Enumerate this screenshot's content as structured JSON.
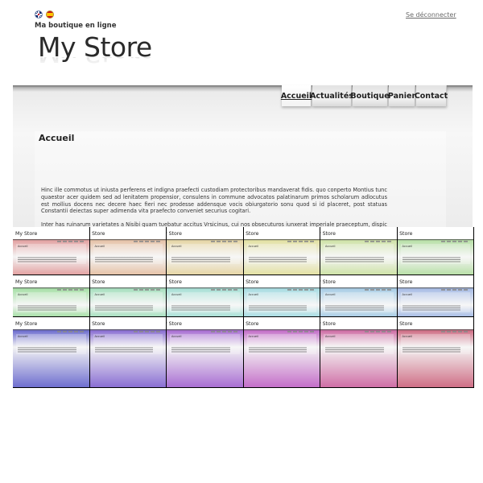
{
  "header": {
    "flags": [
      {
        "icon": "uk-flag-icon",
        "color": "#012169"
      },
      {
        "icon": "spain-flag-icon",
        "color": "#c60b1e"
      }
    ],
    "logout_label": "Se déconnecter",
    "tagline": "Ma boutique en ligne",
    "store_title": "My Store"
  },
  "nav": {
    "items": [
      {
        "label": "Accueil",
        "active": true
      },
      {
        "label": "Actualités",
        "active": false
      },
      {
        "label": "Boutique",
        "active": false
      },
      {
        "label": "Panier",
        "active": false
      },
      {
        "label": "Contact",
        "active": false
      }
    ]
  },
  "main": {
    "heading": "Accueil",
    "paragraph1": "Hinc ille commotus ut iniusta perferens et indigna praefecti custodiam protectoribus mandaverat fidis. quo conperto Montius tunc quaestor acer quidem sed ad lenitatem propensior, consulens in commune advocatos palatinarum primos scholarum adlocutus est mollius docens nec decere haec fieri nec prodesse addensque vocis obiurgatorio sonu quod si id placeret, post statuas Constantii deiectas super adimenda vita praefecto conveniet securius cogitari.",
    "paragraph2": "Inter has ruinarum varietates a Nisibi quam tuebatur accitus Vrsicinus, cui nos obsecuturos iunxerat imperiale praeceptum, dispicere litis"
  },
  "thumbnails": {
    "logo_text": "My Store",
    "logo_text_cropped": "y Store",
    "heading": "Accueil",
    "rows": [
      [
        {
          "color": "#e3a3a3",
          "logo": "full"
        },
        {
          "color": "#e6c3a8",
          "logo": "cropped"
        },
        {
          "color": "#e6d6a6",
          "logo": "cropped"
        },
        {
          "color": "#e3e1a3",
          "logo": "cropped"
        },
        {
          "color": "#cfe3a8",
          "logo": "cropped"
        },
        {
          "color": "#b9e0a8",
          "logo": "cropped"
        }
      ],
      [
        {
          "color": "#a8e0a8",
          "logo": "full"
        },
        {
          "color": "#a8e0c0",
          "logo": "cropped"
        },
        {
          "color": "#a8e0d6",
          "logo": "cropped"
        },
        {
          "color": "#a8dde3",
          "logo": "cropped"
        },
        {
          "color": "#a8cde6",
          "logo": "cropped"
        },
        {
          "color": "#a8bde6",
          "logo": "cropped"
        }
      ],
      [
        {
          "color": "#6f6fcf",
          "logo": "full"
        },
        {
          "color": "#8a6fd3",
          "logo": "cropped"
        },
        {
          "color": "#a96fd3",
          "logo": "cropped"
        },
        {
          "color": "#c46fc9",
          "logo": "cropped"
        },
        {
          "color": "#cf6fa6",
          "logo": "cropped"
        },
        {
          "color": "#cf6f86",
          "logo": "cropped"
        }
      ]
    ]
  }
}
